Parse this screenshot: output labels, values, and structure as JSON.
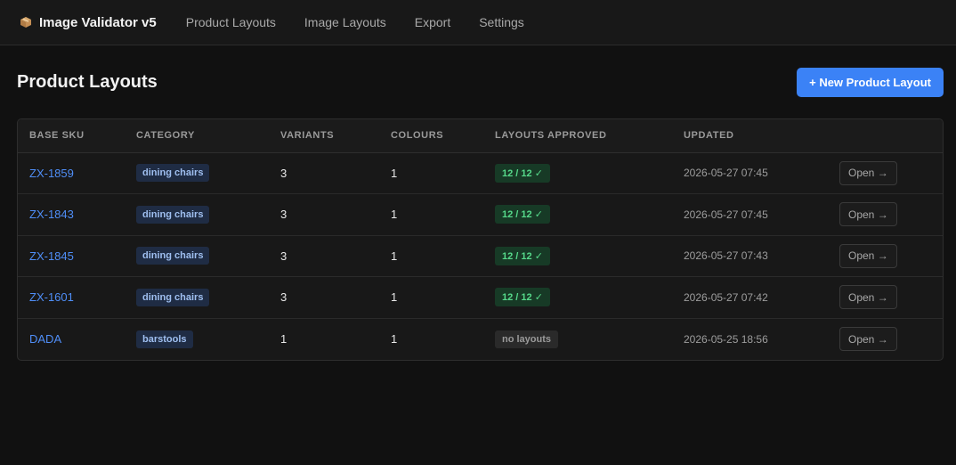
{
  "app": {
    "title": "Image Validator v5",
    "brand_icon": "package-icon"
  },
  "nav": {
    "items": [
      {
        "label": "Product Layouts"
      },
      {
        "label": "Image Layouts"
      },
      {
        "label": "Export"
      },
      {
        "label": "Settings"
      }
    ]
  },
  "page": {
    "title": "Product Layouts",
    "new_button": "+ New Product Layout"
  },
  "table": {
    "headers": [
      "BASE SKU",
      "CATEGORY",
      "VARIANTS",
      "COLOURS",
      "LAYOUTS APPROVED",
      "UPDATED"
    ],
    "rows": [
      {
        "sku": "ZX-1859",
        "category": "dining chairs",
        "variants": "3",
        "colours": "1",
        "approved": "12 / 12 ✓",
        "approved_status": "complete",
        "updated": "2026-05-27 07:45",
        "action": "Open →"
      },
      {
        "sku": "ZX-1843",
        "category": "dining chairs",
        "variants": "3",
        "colours": "1",
        "approved": "12 / 12 ✓",
        "approved_status": "complete",
        "updated": "2026-05-27 07:45",
        "action": "Open →"
      },
      {
        "sku": "ZX-1845",
        "category": "dining chairs",
        "variants": "3",
        "colours": "1",
        "approved": "12 / 12 ✓",
        "approved_status": "complete",
        "updated": "2026-05-27 07:43",
        "action": "Open →"
      },
      {
        "sku": "ZX-1601",
        "category": "dining chairs",
        "variants": "3",
        "colours": "1",
        "approved": "12 / 12 ✓",
        "approved_status": "complete",
        "updated": "2026-05-27 07:42",
        "action": "Open →"
      },
      {
        "sku": "DADA",
        "category": "barstools",
        "variants": "1",
        "colours": "1",
        "approved": "no layouts",
        "approved_status": "none",
        "updated": "2026-05-25 18:56",
        "action": "Open →"
      }
    ]
  },
  "colors": {
    "accent": "#3b82f6",
    "link": "#4f8ef7",
    "approved_bg": "#173a26",
    "approved_text": "#56d98a",
    "background": "#111111"
  }
}
